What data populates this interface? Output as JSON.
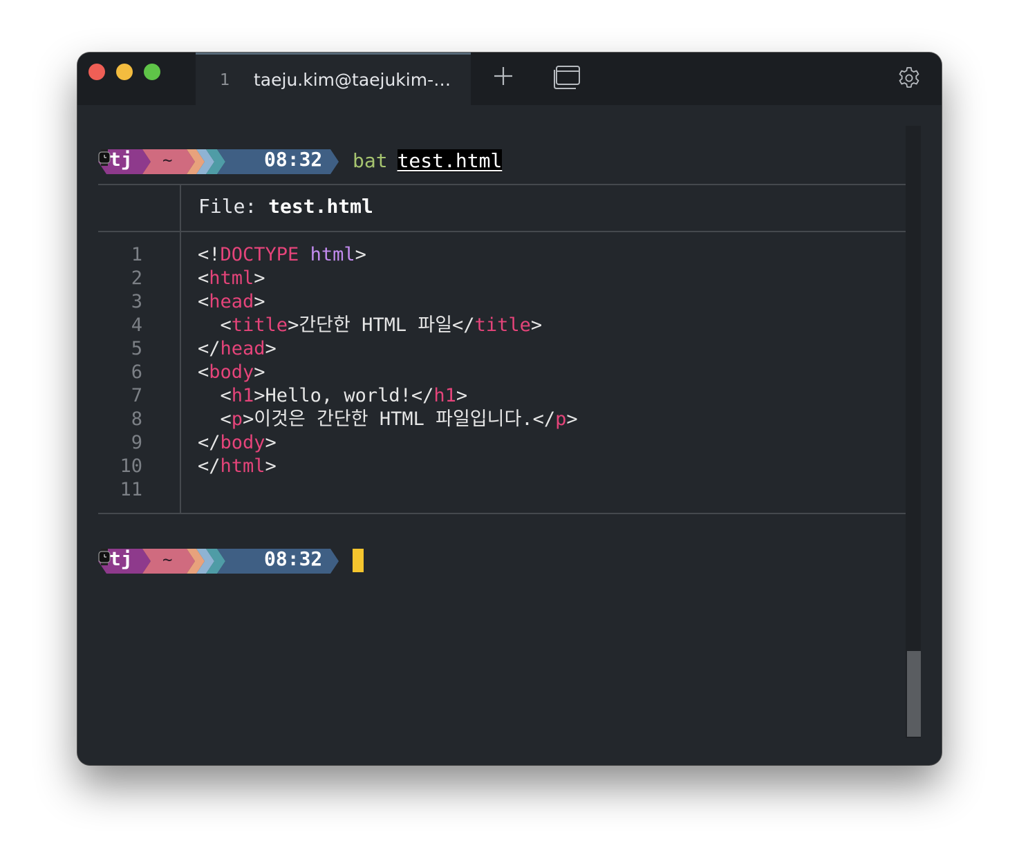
{
  "tab": {
    "number": "1",
    "title": "taeju.kim@taejukim-…"
  },
  "prompt": {
    "user": "tj",
    "dir": "~",
    "time": "08:32"
  },
  "command": {
    "program": "bat",
    "argument": "test.html"
  },
  "bat": {
    "file_label": "File:",
    "file_name": "test.html",
    "line_numbers": [
      "1",
      "2",
      "3",
      "4",
      "5",
      "6",
      "7",
      "8",
      "9",
      "10",
      "11"
    ],
    "lines": [
      [
        {
          "t": "<!",
          "c": "p"
        },
        {
          "t": "DOCTYPE",
          "c": "tag"
        },
        {
          "t": " ",
          "c": "p"
        },
        {
          "t": "html",
          "c": "kw"
        },
        {
          "t": ">",
          "c": "p"
        }
      ],
      [
        {
          "t": "<",
          "c": "p"
        },
        {
          "t": "html",
          "c": "tag"
        },
        {
          "t": ">",
          "c": "p"
        }
      ],
      [
        {
          "t": "<",
          "c": "p"
        },
        {
          "t": "head",
          "c": "tag"
        },
        {
          "t": ">",
          "c": "p"
        }
      ],
      [
        {
          "t": "  <",
          "c": "p"
        },
        {
          "t": "title",
          "c": "tag"
        },
        {
          "t": ">간단한 HTML 파일</",
          "c": "p"
        },
        {
          "t": "title",
          "c": "tag"
        },
        {
          "t": ">",
          "c": "p"
        }
      ],
      [
        {
          "t": "</",
          "c": "p"
        },
        {
          "t": "head",
          "c": "tag"
        },
        {
          "t": ">",
          "c": "p"
        }
      ],
      [
        {
          "t": "<",
          "c": "p"
        },
        {
          "t": "body",
          "c": "tag"
        },
        {
          "t": ">",
          "c": "p"
        }
      ],
      [
        {
          "t": "  <",
          "c": "p"
        },
        {
          "t": "h1",
          "c": "tag"
        },
        {
          "t": ">Hello, world!</",
          "c": "p"
        },
        {
          "t": "h1",
          "c": "tag"
        },
        {
          "t": ">",
          "c": "p"
        }
      ],
      [
        {
          "t": "  <",
          "c": "p"
        },
        {
          "t": "p",
          "c": "tag"
        },
        {
          "t": ">이것은 간단한 HTML 파일입니다.</",
          "c": "p"
        },
        {
          "t": "p",
          "c": "tag"
        },
        {
          "t": ">",
          "c": "p"
        }
      ],
      [
        {
          "t": "</",
          "c": "p"
        },
        {
          "t": "body",
          "c": "tag"
        },
        {
          "t": ">",
          "c": "p"
        }
      ],
      [
        {
          "t": "</",
          "c": "p"
        },
        {
          "t": "html",
          "c": "tag"
        },
        {
          "t": ">",
          "c": "p"
        }
      ],
      []
    ]
  },
  "colors": {
    "background": "#23272c",
    "titlebar": "#1b1e22",
    "tag": "#e5447a",
    "keyword": "#c38bf0",
    "command": "#a6c46f",
    "cursor": "#f5c52e",
    "prompt_user_segment": "#8e3a8c",
    "prompt_dir_segment": "#d06b7f",
    "prompt_time_segment": "#3f5f84"
  },
  "icons": [
    "close-traffic-light",
    "minimize-traffic-light",
    "zoom-traffic-light",
    "plus-icon",
    "window-stack-icon",
    "gear-icon",
    "watch-icon"
  ]
}
